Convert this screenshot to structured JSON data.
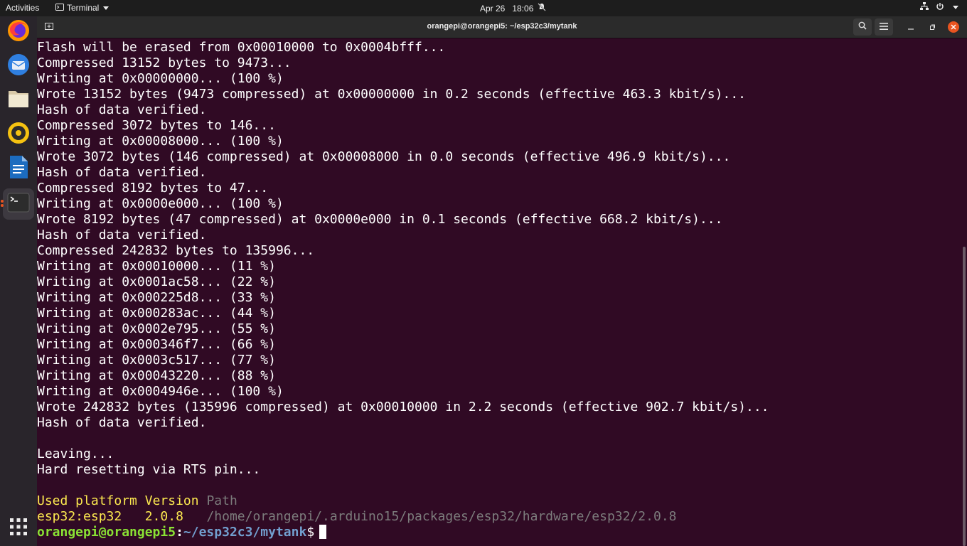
{
  "topbar": {
    "activities": "Activities",
    "app_menu": "Terminal",
    "date": "Apr 26",
    "time": "18:06"
  },
  "dock": {
    "items": [
      "firefox-icon",
      "thunderbird-icon",
      "files-icon",
      "rhythmbox-icon",
      "writer-icon",
      "terminal-icon"
    ],
    "active": "terminal-icon"
  },
  "window": {
    "title": "orangepi@orangepi5: ~/esp32c3/mytank"
  },
  "terminal": {
    "lines": [
      "Flash will be erased from 0x00010000 to 0x0004bfff...",
      "Compressed 13152 bytes to 9473...",
      "Writing at 0x00000000... (100 %)",
      "Wrote 13152 bytes (9473 compressed) at 0x00000000 in 0.2 seconds (effective 463.3 kbit/s)...",
      "Hash of data verified.",
      "Compressed 3072 bytes to 146...",
      "Writing at 0x00008000... (100 %)",
      "Wrote 3072 bytes (146 compressed) at 0x00008000 in 0.0 seconds (effective 496.9 kbit/s)...",
      "Hash of data verified.",
      "Compressed 8192 bytes to 47...",
      "Writing at 0x0000e000... (100 %)",
      "Wrote 8192 bytes (47 compressed) at 0x0000e000 in 0.1 seconds (effective 668.2 kbit/s)...",
      "Hash of data verified.",
      "Compressed 242832 bytes to 135996...",
      "Writing at 0x00010000... (11 %)",
      "Writing at 0x0001ac58... (22 %)",
      "Writing at 0x000225d8... (33 %)",
      "Writing at 0x000283ac... (44 %)",
      "Writing at 0x0002e795... (55 %)",
      "Writing at 0x000346f7... (66 %)",
      "Writing at 0x0003c517... (77 %)",
      "Writing at 0x00043220... (88 %)",
      "Writing at 0x0004946e... (100 %)",
      "Wrote 242832 bytes (135996 compressed) at 0x00010000 in 2.2 seconds (effective 902.7 kbit/s)...",
      "Hash of data verified.",
      "",
      "Leaving...",
      "Hard resetting via RTS pin...",
      ""
    ],
    "platform_header": {
      "used": "Used platform",
      "version": "Version",
      "path": "Path"
    },
    "platform_row": {
      "name": "esp32:esp32",
      "version": "2.0.8",
      "path": "/home/orangepi/.arduino15/packages/esp32/hardware/esp32/2.0.8"
    },
    "prompt": {
      "user_host": "orangepi@orangepi5",
      "separator": ":",
      "path": "~/esp32c3/mytank",
      "symbol": "$"
    }
  },
  "colors": {
    "terminal_bg": "#300a24",
    "accent": "#e95420",
    "green": "#8ae234",
    "blue": "#729fcf"
  }
}
